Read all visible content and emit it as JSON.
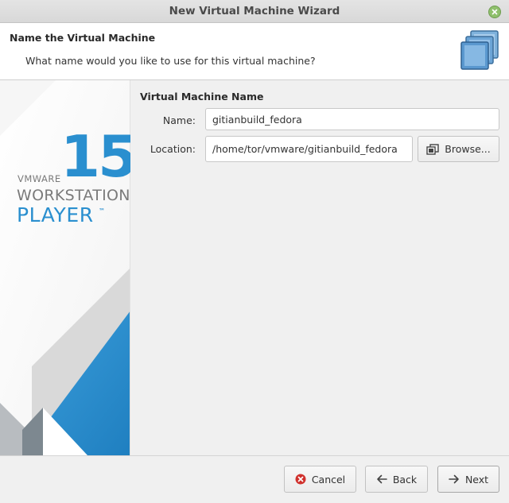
{
  "window": {
    "title": "New Virtual Machine Wizard"
  },
  "header": {
    "title": "Name the Virtual Machine",
    "subtitle": "What name would you like to use for this virtual machine?"
  },
  "brand": {
    "version": "15",
    "vendor": "VMWARE",
    "product_line1": "WORKSTATION",
    "product_line2": "PLAYER",
    "trademark": "™",
    "accent_color": "#2a8fcf"
  },
  "form": {
    "section_title": "Virtual Machine Name",
    "name_label": "Name:",
    "name_value": "gitianbuild_fedora",
    "location_label": "Location:",
    "location_value": "/home/tor/vmware/gitianbuild_fedora",
    "browse_label": "Browse..."
  },
  "footer": {
    "cancel_label": "Cancel",
    "back_label": "Back",
    "next_label": "Next"
  },
  "icons": {
    "close": "close-icon",
    "wizard": "virtual-machine-icon",
    "browse": "folder-copy-icon",
    "cancel": "cancel-icon",
    "back": "arrow-left-icon",
    "next": "arrow-right-icon"
  }
}
